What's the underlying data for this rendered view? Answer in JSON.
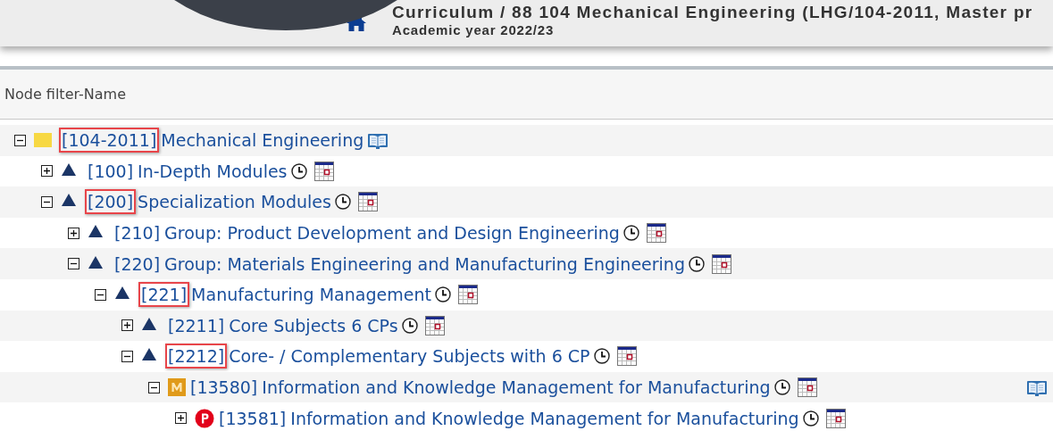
{
  "header": {
    "title": "Curriculum  / 88 104 Mechanical Engineering (LHG/104-2011, Master pr",
    "subtitle": "Academic year 2022/23"
  },
  "filter": {
    "label": "Node filter-Name"
  },
  "tree": [
    {
      "kind": "folder",
      "code": "[104-2011]",
      "title": "Mechanical Engineering",
      "highlighted": true,
      "expanded": true,
      "clock": false,
      "calendar": false,
      "book": true,
      "side_book": false,
      "children": [
        {
          "kind": "group",
          "code": "[100]",
          "title": "In-Depth Modules",
          "highlighted": false,
          "expanded": false,
          "clock": true,
          "calendar": true,
          "book": false,
          "side_book": false
        },
        {
          "kind": "group",
          "code": "[200]",
          "title": "Specialization Modules",
          "highlighted": true,
          "expanded": true,
          "clock": true,
          "calendar": true,
          "book": false,
          "side_book": false,
          "children": [
            {
              "kind": "group",
              "code": "[210]",
              "title": "Group: Product Development and Design Engineering",
              "highlighted": false,
              "expanded": false,
              "clock": true,
              "calendar": true,
              "book": false,
              "side_book": false
            },
            {
              "kind": "group",
              "code": "[220]",
              "title": "Group: Materials Engineering and Manufacturing Engineering",
              "highlighted": false,
              "expanded": true,
              "clock": true,
              "calendar": true,
              "book": false,
              "side_book": false,
              "children": [
                {
                  "kind": "group",
                  "code": "[221]",
                  "title": "Manufacturing Management",
                  "highlighted": true,
                  "expanded": true,
                  "clock": true,
                  "calendar": true,
                  "book": false,
                  "side_book": false,
                  "children": [
                    {
                      "kind": "group",
                      "code": "[2211]",
                      "title": "Core Subjects 6 CPs",
                      "highlighted": false,
                      "expanded": false,
                      "clock": true,
                      "calendar": true,
                      "book": false,
                      "side_book": false
                    },
                    {
                      "kind": "group",
                      "code": "[2212]",
                      "title": "Core- / Complementary Subjects with 6 CP",
                      "highlighted": true,
                      "expanded": true,
                      "clock": true,
                      "calendar": true,
                      "book": false,
                      "side_book": false,
                      "children": [
                        {
                          "kind": "module",
                          "code": "[13580]",
                          "title": "Information and Knowledge Management for Manufacturing",
                          "highlighted": false,
                          "expanded": true,
                          "clock": true,
                          "calendar": true,
                          "book": false,
                          "side_book": true,
                          "children": [
                            {
                              "kind": "exam",
                              "code": "[13581]",
                              "title": "Information and Knowledge Management for Manufacturing",
                              "highlighted": false,
                              "expanded": false,
                              "clock": true,
                              "calendar": true,
                              "book": false,
                              "side_book": false
                            }
                          ]
                        }
                      ]
                    }
                  ]
                }
              ]
            }
          ]
        }
      ]
    }
  ]
}
